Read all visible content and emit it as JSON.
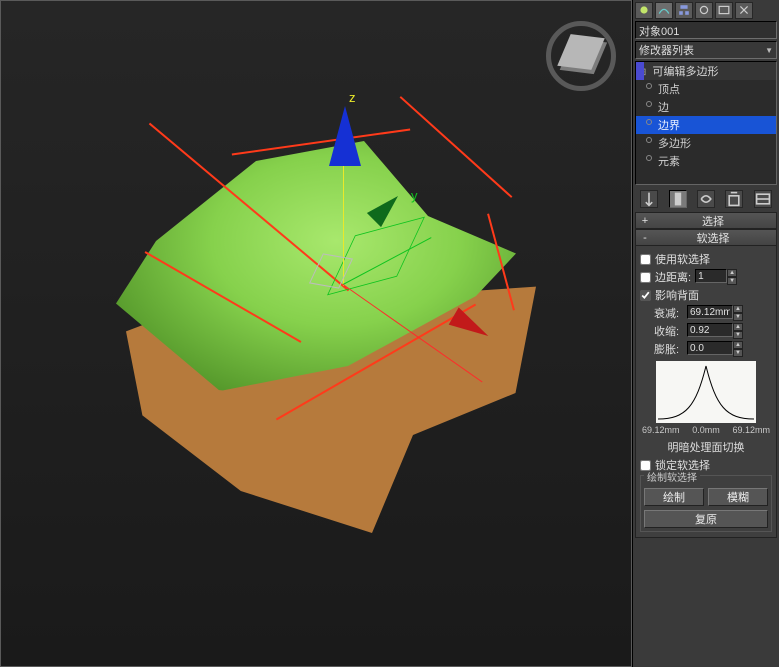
{
  "object_name": "对象001",
  "modifier_dropdown": "修改器列表",
  "stack": {
    "root": "可编辑多边形",
    "items": [
      "顶点",
      "边",
      "边界",
      "多边形",
      "元素"
    ],
    "selected_index": 2
  },
  "axes": {
    "x": "",
    "y": "y",
    "z": "z"
  },
  "rollouts": {
    "selection": {
      "title": "选择",
      "pm": "+"
    },
    "soft": {
      "title": "软选择",
      "pm": "-",
      "use_soft": "使用软选择",
      "use_soft_checked": false,
      "edge_dist": "边距离:",
      "edge_dist_val": "1",
      "edge_dist_checked": false,
      "affect_backface": "影响背面",
      "affect_backface_checked": true,
      "falloff_lbl": "衰减:",
      "falloff_val": "69.12mm",
      "pinch_lbl": "收缩:",
      "pinch_val": "0.92",
      "bubble_lbl": "膨胀:",
      "bubble_val": "0.0",
      "grad_left": "69.12mm",
      "grad_mid": "0.0mm",
      "grad_right": "69.12mm",
      "shaded_toggle": "明暗处理面切换",
      "lock_soft": "锁定软选择",
      "lock_soft_checked": false,
      "paint_group": "绘制软选择",
      "paint_btn": "绘制",
      "blur_btn": "模糊",
      "revert_btn": "复原"
    }
  }
}
